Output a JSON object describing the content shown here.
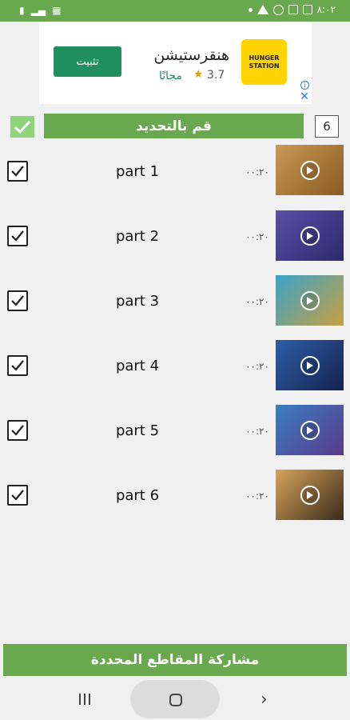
{
  "status_bar": {
    "time": "٨:٠٢",
    "notif_icons": [
      "sim-icon",
      "bars-icon",
      "grid-icon"
    ],
    "right_icons": [
      "dot-icon",
      "warning-icon",
      "whatsapp-icon",
      "image-icon",
      "box-icon"
    ]
  },
  "ad": {
    "install_label": "تثبيت",
    "app_name": "هنقرستيشن",
    "rating": "3.7",
    "price": "مجانًا",
    "logo_line1": "HUNGER",
    "logo_line2": "STATION"
  },
  "header": {
    "select_label": "قم بالتحديد",
    "count": "6"
  },
  "videos": [
    {
      "title": "part 1",
      "duration": "٠٠:٢٠",
      "thumb_color": "#c99a55",
      "thumb_color2": "#8a5a22",
      "checked": true
    },
    {
      "title": "part 2",
      "duration": "٠٠:٢٠",
      "thumb_color": "#5b4ea6",
      "thumb_color2": "#2b2a6e",
      "checked": true
    },
    {
      "title": "part 3",
      "duration": "٠٠:٢٠",
      "thumb_color": "#3aa3c9",
      "thumb_color2": "#c8a040",
      "checked": true
    },
    {
      "title": "part 4",
      "duration": "٠٠:٢٠",
      "thumb_color": "#2d5ea8",
      "thumb_color2": "#15224f",
      "checked": true
    },
    {
      "title": "part 5",
      "duration": "٠٠:٢٠",
      "thumb_color": "#3a7ec2",
      "thumb_color2": "#5a3a8a",
      "checked": true
    },
    {
      "title": "part 6",
      "duration": "٠٠:٢٠",
      "thumb_color": "#d7a45a",
      "thumb_color2": "#3a2a1a",
      "checked": true
    }
  ],
  "share_label": "مشاركة المقاطع المحددة",
  "colors": {
    "accent": "#6aa84f",
    "select_check": "#8fd37a",
    "install_button": "#1f8f5f"
  }
}
